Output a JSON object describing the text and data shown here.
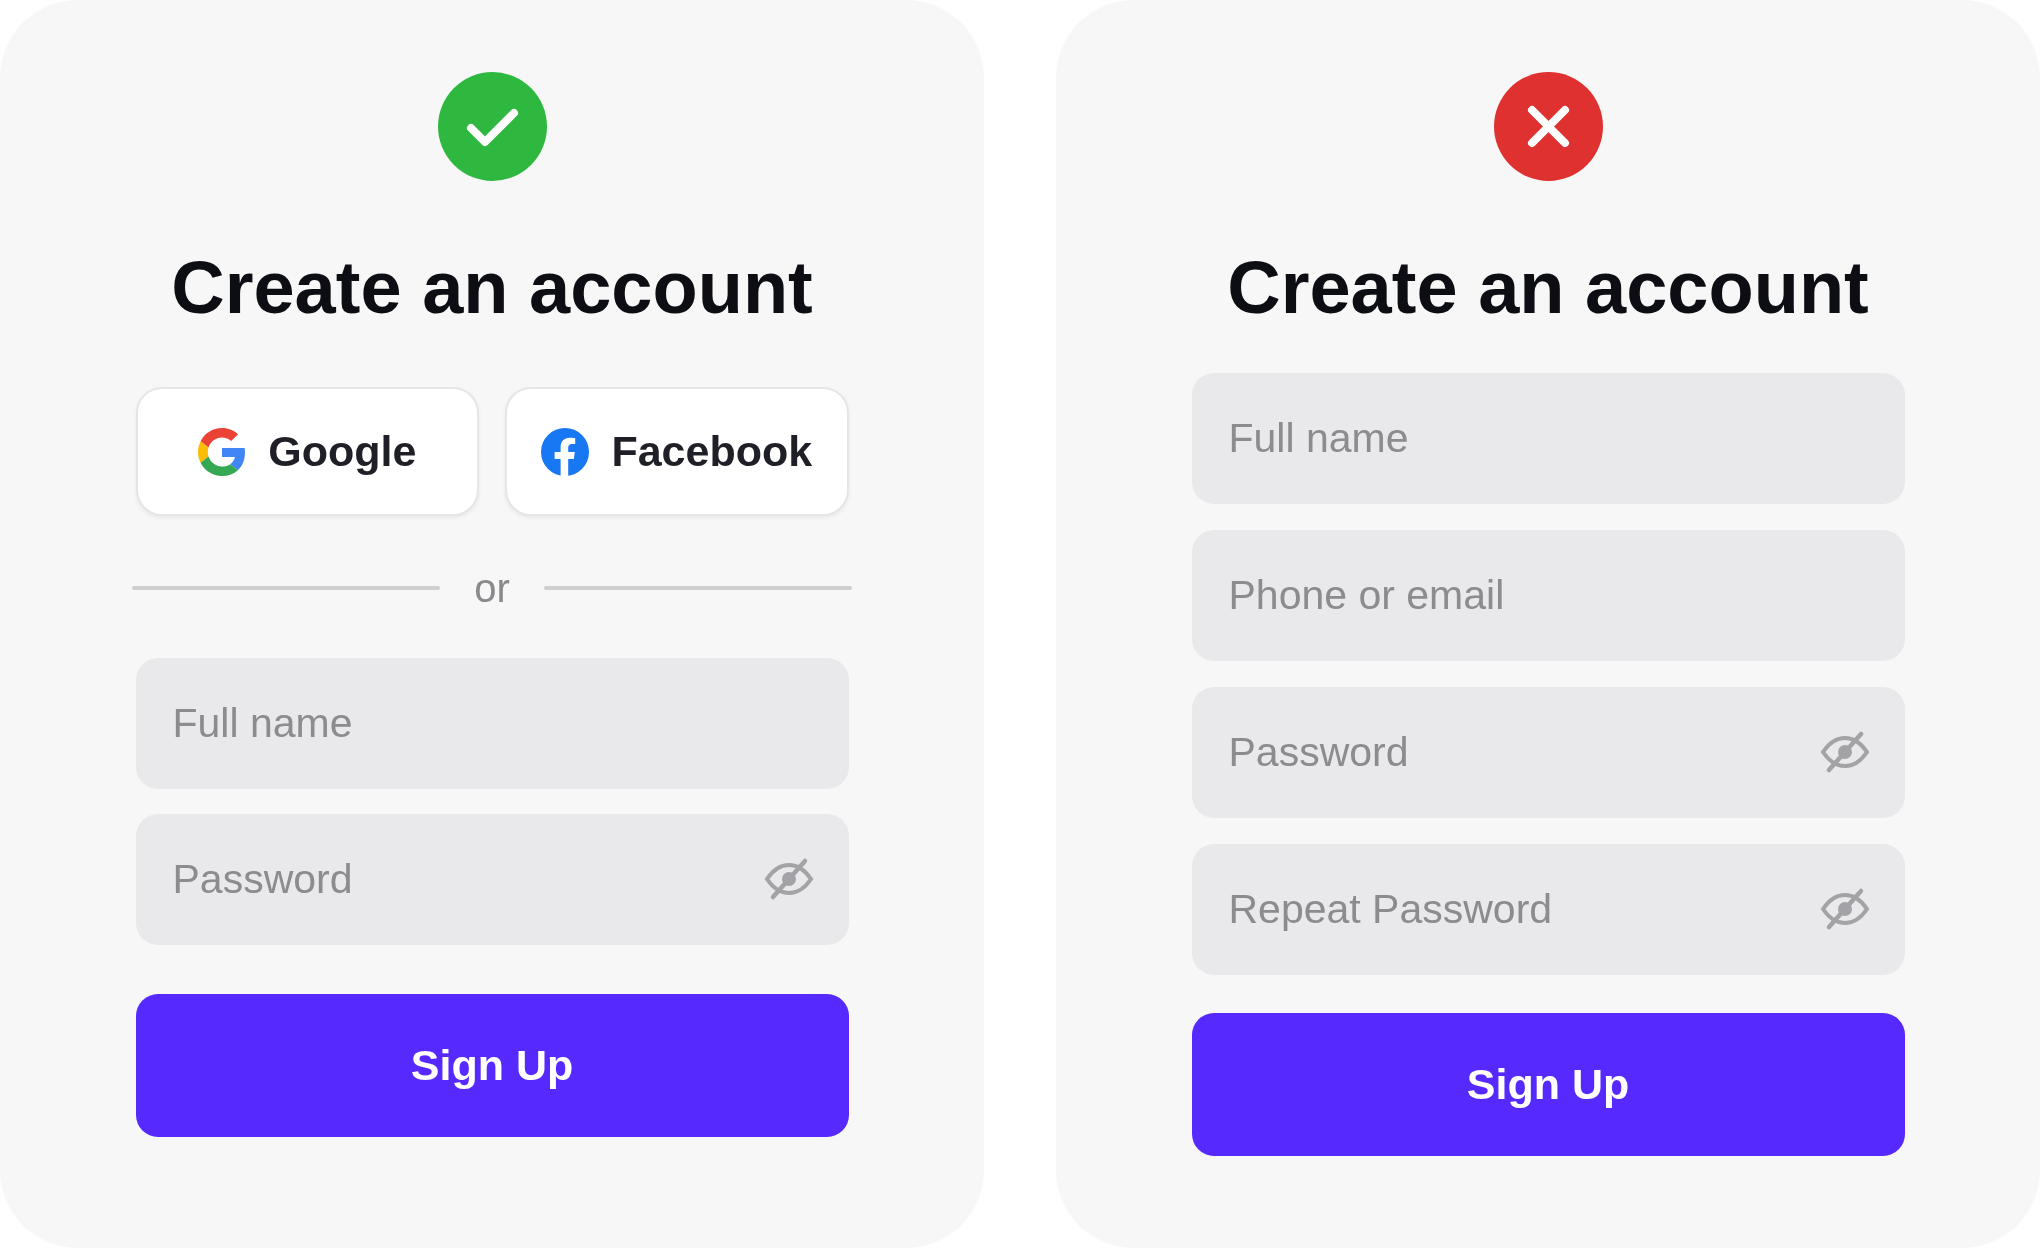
{
  "cards": [
    {
      "kind": "good",
      "title": "Create an account",
      "social_buttons": [
        {
          "kind": "google",
          "label": "Google"
        },
        {
          "kind": "facebook",
          "label": "Facebook"
        }
      ],
      "divider_label": "or",
      "fields": [
        {
          "placeholder": "Full name",
          "password": false
        },
        {
          "placeholder": "Password",
          "password": true
        }
      ],
      "submit": "Sign Up"
    },
    {
      "kind": "bad",
      "title": "Create an account",
      "fields": [
        {
          "placeholder": "Full name",
          "password": false
        },
        {
          "placeholder": "Phone or email",
          "password": false
        },
        {
          "placeholder": "Password",
          "password": true
        },
        {
          "placeholder": "Repeat Password",
          "password": true
        }
      ],
      "submit": "Sign Up"
    }
  ]
}
